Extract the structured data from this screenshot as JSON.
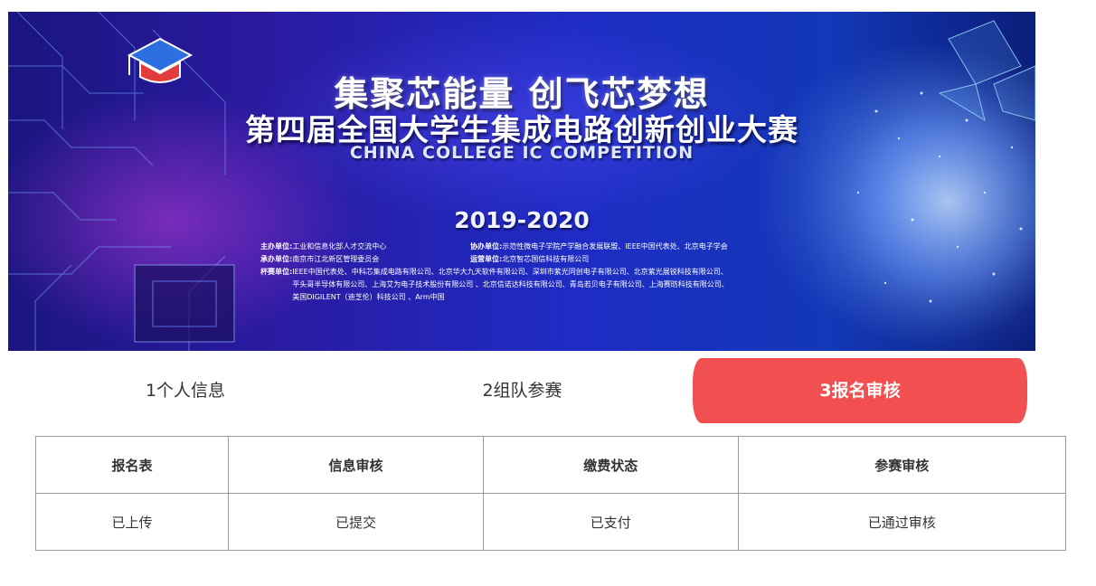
{
  "banner": {
    "slogan": "集聚芯能量  创飞芯梦想",
    "title": "第四届全国大学生集成电路创新创业大赛",
    "subtitle_en": "CHINA COLLEGE IC COMPETITION",
    "years": "2019-2020",
    "logo_icon": "graduation-cap-icon",
    "organizers": {
      "host_label": "主办单位:",
      "host_value": "工业和信息化部人才交流中心",
      "co_label": "协办单位:",
      "co_value": "示范性微电子学院产学融合发展联盟、IEEE中国代表处、北京电子学会",
      "undertake_label": "承办单位:",
      "undertake_value": "南京市江北新区管理委员会",
      "operate_label": "运营单位:",
      "operate_value": "北京智芯国信科技有限公司",
      "cup_label": "杯赛单位:",
      "cup_line1": "IEEE中国代表处、中科芯集成电路有限公司、北京华大九天软件有限公司、深圳市紫光同创电子有限公司、北京紫光展锐科技有限公司、",
      "cup_line2": "平头哥半导体有限公司、上海艾为电子技术股份有限公司 、北京信诺达科技有限公司、青岛若贝电子有限公司、上海赛昉科技有限公司、",
      "cup_line3": "美国DIGILENT（迪芝伦）科技公司 、Arm中国"
    }
  },
  "steps": [
    {
      "label": "1个人信息",
      "active": false
    },
    {
      "label": "2组队参赛",
      "active": false
    },
    {
      "label": "3报名审核",
      "active": true
    }
  ],
  "table": {
    "headers": [
      "报名表",
      "信息审核",
      "缴费状态",
      "参赛审核"
    ],
    "row": [
      "已上传",
      "已提交",
      "已支付",
      "已通过审核"
    ]
  },
  "colors": {
    "active_step": "#f25050",
    "banner_blue": "#1e2cc4",
    "banner_purple": "#2a1aa0"
  }
}
